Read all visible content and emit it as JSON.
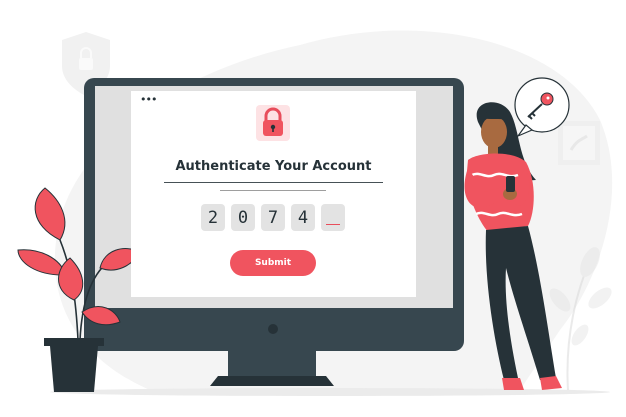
{
  "auth": {
    "title": "Authenticate Your Account",
    "digits": [
      "2",
      "0",
      "7",
      "4",
      ""
    ],
    "submit_label": "Submit",
    "window_dots": "•••"
  },
  "colors": {
    "accent": "#f0545f",
    "dark": "#263238",
    "monitor_frame": "#37474f",
    "monitor_bezel": "#e0e0e0",
    "background_shape": "#f2f2f2"
  },
  "icons": [
    "lock-icon",
    "key-icon",
    "shield-icon",
    "phone-icon"
  ]
}
